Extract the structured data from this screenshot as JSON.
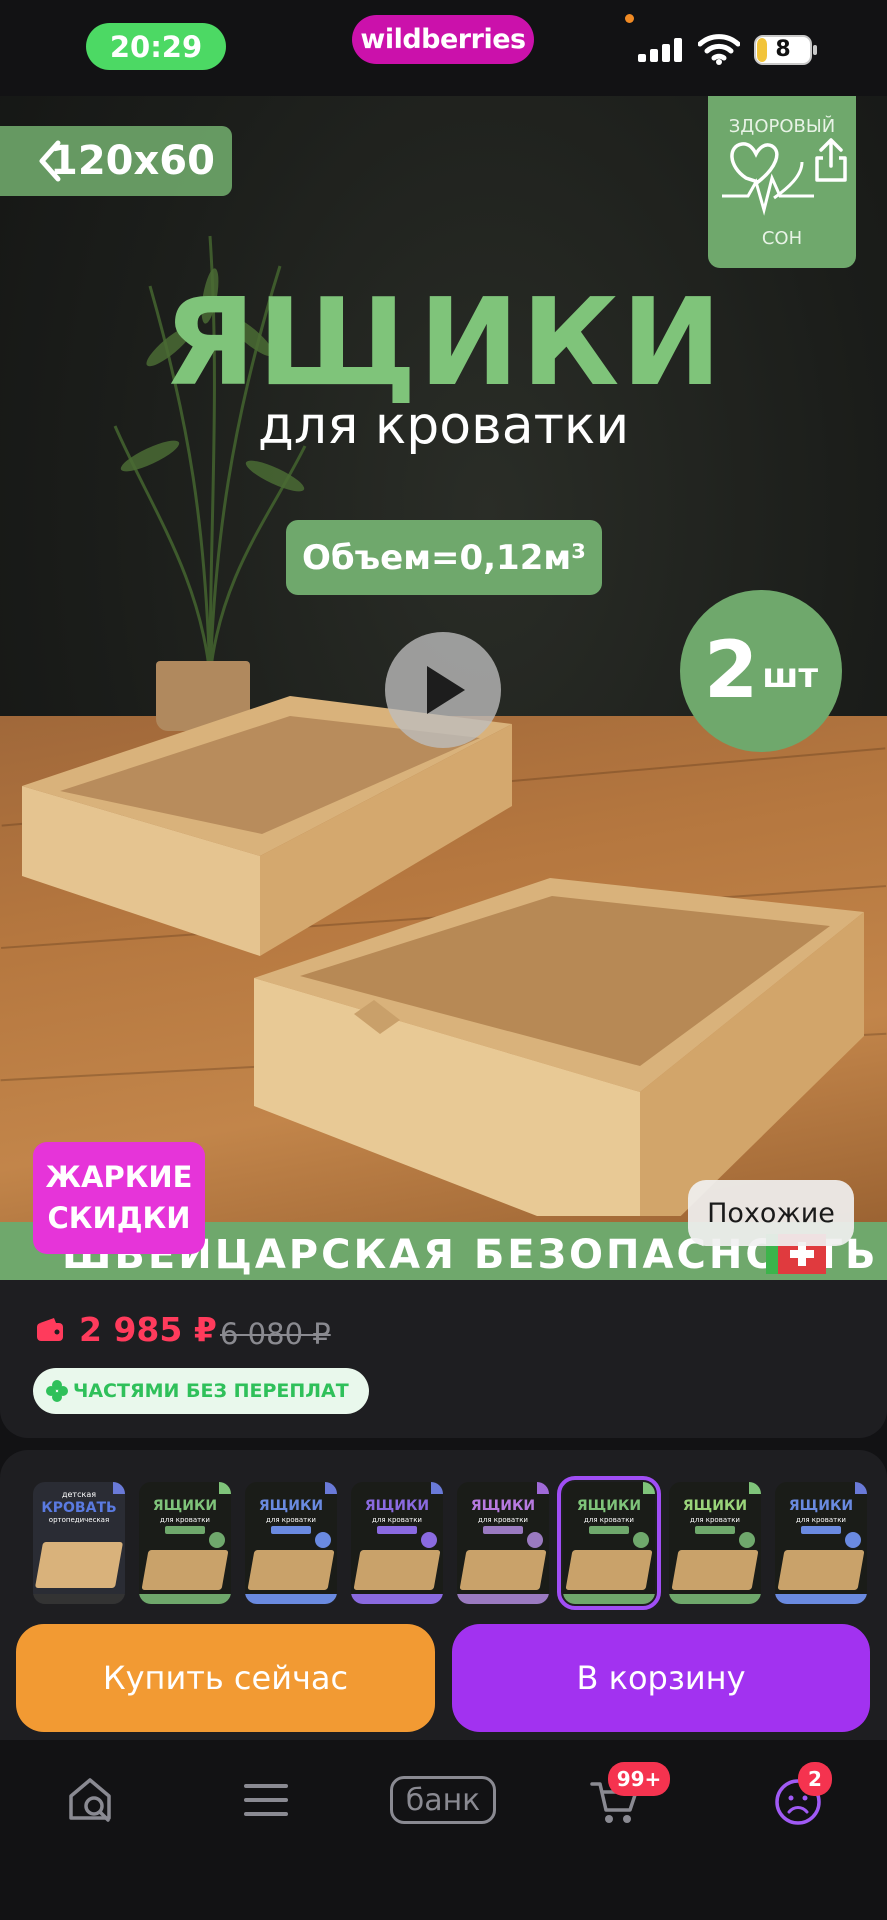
{
  "status_bar": {
    "time": "20:29",
    "brand": "wildberries",
    "battery": "8",
    "colors": {
      "time_pill": "#4cd964",
      "brand_pill": "#cb11ab"
    }
  },
  "hero": {
    "size_tag": "120x60",
    "health_badge": {
      "top": "ЗДОРОВЫЙ",
      "bottom": "СОН"
    },
    "headline": "ЯЩИКИ",
    "subline": "для кроватки",
    "volume": "Объем=0,12м³",
    "quantity_number": "2",
    "quantity_unit": "шт",
    "banner": "ШВЕЙЦАРСКАЯ  БЕЗОПАСНОСТЬ",
    "hot_badge_line1": "ЖАРКИЕ",
    "hot_badge_line2": "СКИДКИ",
    "similar_button": "Похожие",
    "colors": {
      "accent_green": "#6fa86c",
      "headline_green": "#7fc47a",
      "hot_pink": "#e634d9"
    }
  },
  "price": {
    "current": "2 985 ₽",
    "old": "6 080 ₽",
    "installment": "ЧАСТЯМИ БЕЗ ПЕРЕПЛАТ",
    "colors": {
      "current": "#ff3b5c",
      "installment_text": "#2fc05a"
    }
  },
  "thumbnails": {
    "bed": {
      "label": "детская",
      "title": "КРОВАТЬ",
      "sub": "ортопедическая"
    },
    "drawer_title": "ЯЩИКИ",
    "drawer_sub": "для кроватки",
    "selected_index": 5
  },
  "actions": {
    "buy_now": "Купить сейчас",
    "add_to_cart": "В корзину",
    "colors": {
      "buy_now": "#f29a33",
      "add_to_cart": "#a232f0"
    }
  },
  "tabbar": {
    "items": [
      {
        "name": "home-search",
        "icon": "home-search-icon"
      },
      {
        "name": "catalog",
        "icon": "menu-icon"
      },
      {
        "name": "bank",
        "label": "банк"
      },
      {
        "name": "cart",
        "icon": "cart-icon",
        "badge": "99+"
      },
      {
        "name": "profile",
        "icon": "profile-icon",
        "badge": "2"
      }
    ]
  }
}
